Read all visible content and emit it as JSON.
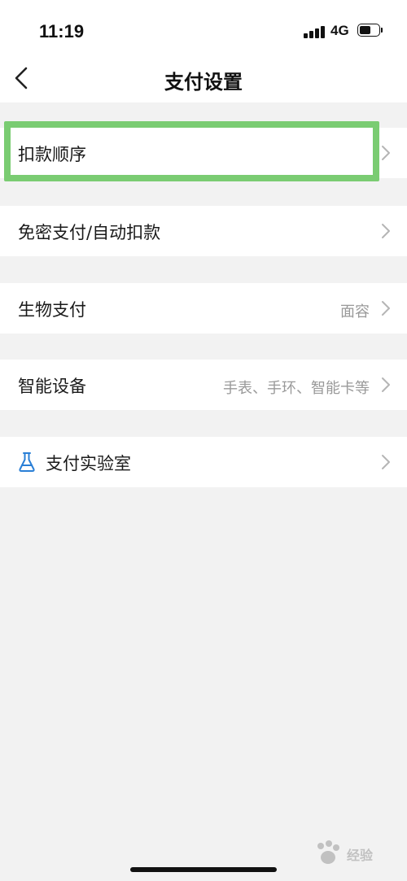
{
  "status_bar": {
    "time": "11:19",
    "network": "4G",
    "battery_level": 0.6
  },
  "nav": {
    "title": "支付设置",
    "back_icon": "chevron-left-icon"
  },
  "settings": {
    "items": [
      {
        "label": "扣款顺序",
        "value": "",
        "highlighted": true
      },
      {
        "label": "免密支付/自动扣款",
        "value": ""
      },
      {
        "label": "生物支付",
        "value": "面容"
      },
      {
        "label": "智能设备",
        "value": "手表、手环、智能卡等"
      },
      {
        "label": "支付实验室",
        "value": "",
        "icon": "flask-icon"
      }
    ]
  },
  "colors": {
    "highlight": "#7acc72",
    "accent_icon": "#2a7fd6",
    "secondary_text": "#999999",
    "background": "#f2f2f2"
  },
  "watermark": {
    "text": "经验"
  }
}
